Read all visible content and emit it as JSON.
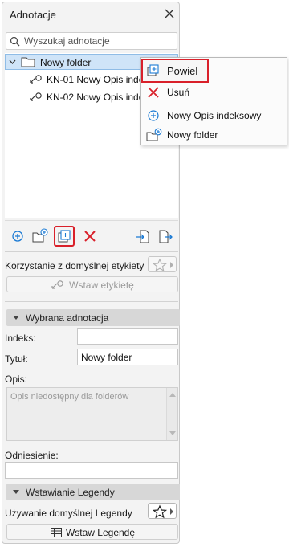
{
  "panel": {
    "title": "Adnotacje"
  },
  "search": {
    "placeholder": "Wyszukaj adnotacje"
  },
  "tree": {
    "folder": "Nowy folder",
    "items": [
      {
        "label": "KN-01 Nowy Opis indeksowy"
      },
      {
        "label": "KN-02 Nowy Opis indeksowy"
      }
    ]
  },
  "context_menu": {
    "items": [
      {
        "label": "Powiel",
        "icon": "duplicate-icon"
      },
      {
        "label": "Usuń",
        "icon": "delete-x-icon"
      },
      {
        "label": "Nowy Opis indeksowy",
        "icon": "add-circle-icon"
      },
      {
        "label": "Nowy folder",
        "icon": "new-folder-icon"
      }
    ]
  },
  "default_label": {
    "text": "Korzystanie z domyślnej etykiety",
    "button": "Wstaw etykietę"
  },
  "selected": {
    "header": "Wybrana adnotacja",
    "index_label": "Indeks:",
    "index_value": "",
    "title_label": "Tytuł:",
    "title_value": "Nowy folder",
    "desc_label": "Opis:",
    "desc_placeholder": "Opis niedostępny dla folderów",
    "ref_label": "Odniesienie:",
    "ref_value": ""
  },
  "legend": {
    "header": "Wstawianie Legendy",
    "default_text": "Używanie domyślnej Legendy",
    "button": "Wstaw Legendę"
  },
  "colors": {
    "accent": "#1a7ad4",
    "highlight": "#d9202a",
    "selection": "#cfe4f8"
  }
}
